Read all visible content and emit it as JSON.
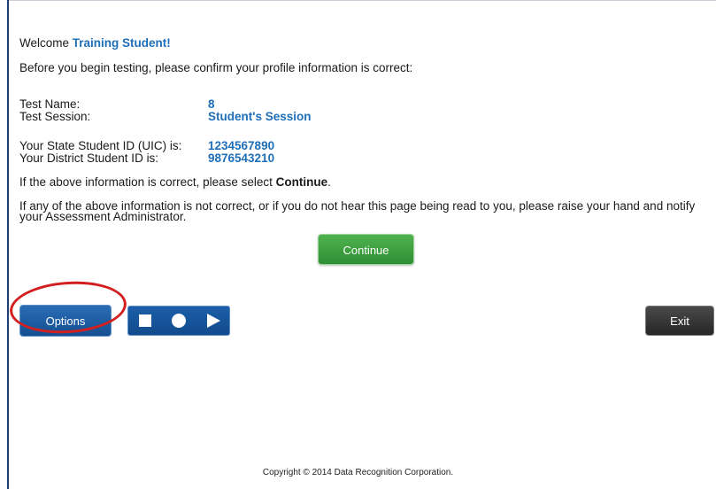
{
  "welcome": {
    "prefix": "Welcome",
    "name": "Training Student!"
  },
  "intro": "Before you begin testing, please confirm your profile information is correct:",
  "test": {
    "name_label": "Test Name:",
    "name_value": "8",
    "session_label": "Test Session:",
    "session_value": "Student's Session"
  },
  "ids": {
    "state_label": "Your State Student ID (UIC) is:",
    "state_value": "1234567890",
    "district_label": "Your District Student ID is:",
    "district_value": "9876543210"
  },
  "confirm_note": {
    "prefix": "If the above information is correct, please select",
    "action": "Continue",
    "suffix": "."
  },
  "incorrect_note": "If any of the above information is not correct, or if you do not hear this page being read to you, please raise your hand and notify your Assessment Administrator.",
  "buttons": {
    "continue": "Continue",
    "options": "Options",
    "exit": "Exit"
  },
  "media_controls": {
    "stop_icon": "stop-icon",
    "pause_icon": "circle-icon",
    "play_icon": "play-icon"
  },
  "colors": {
    "accent_blue": "#1f6fb8",
    "continue_green": "#2f8f35",
    "options_blue": "#144f91",
    "exit_dark": "#262626",
    "annotation_red": "#d21f1f"
  },
  "footer": {
    "copyright": "Copyright © 2014 Data Recognition Corporation."
  }
}
